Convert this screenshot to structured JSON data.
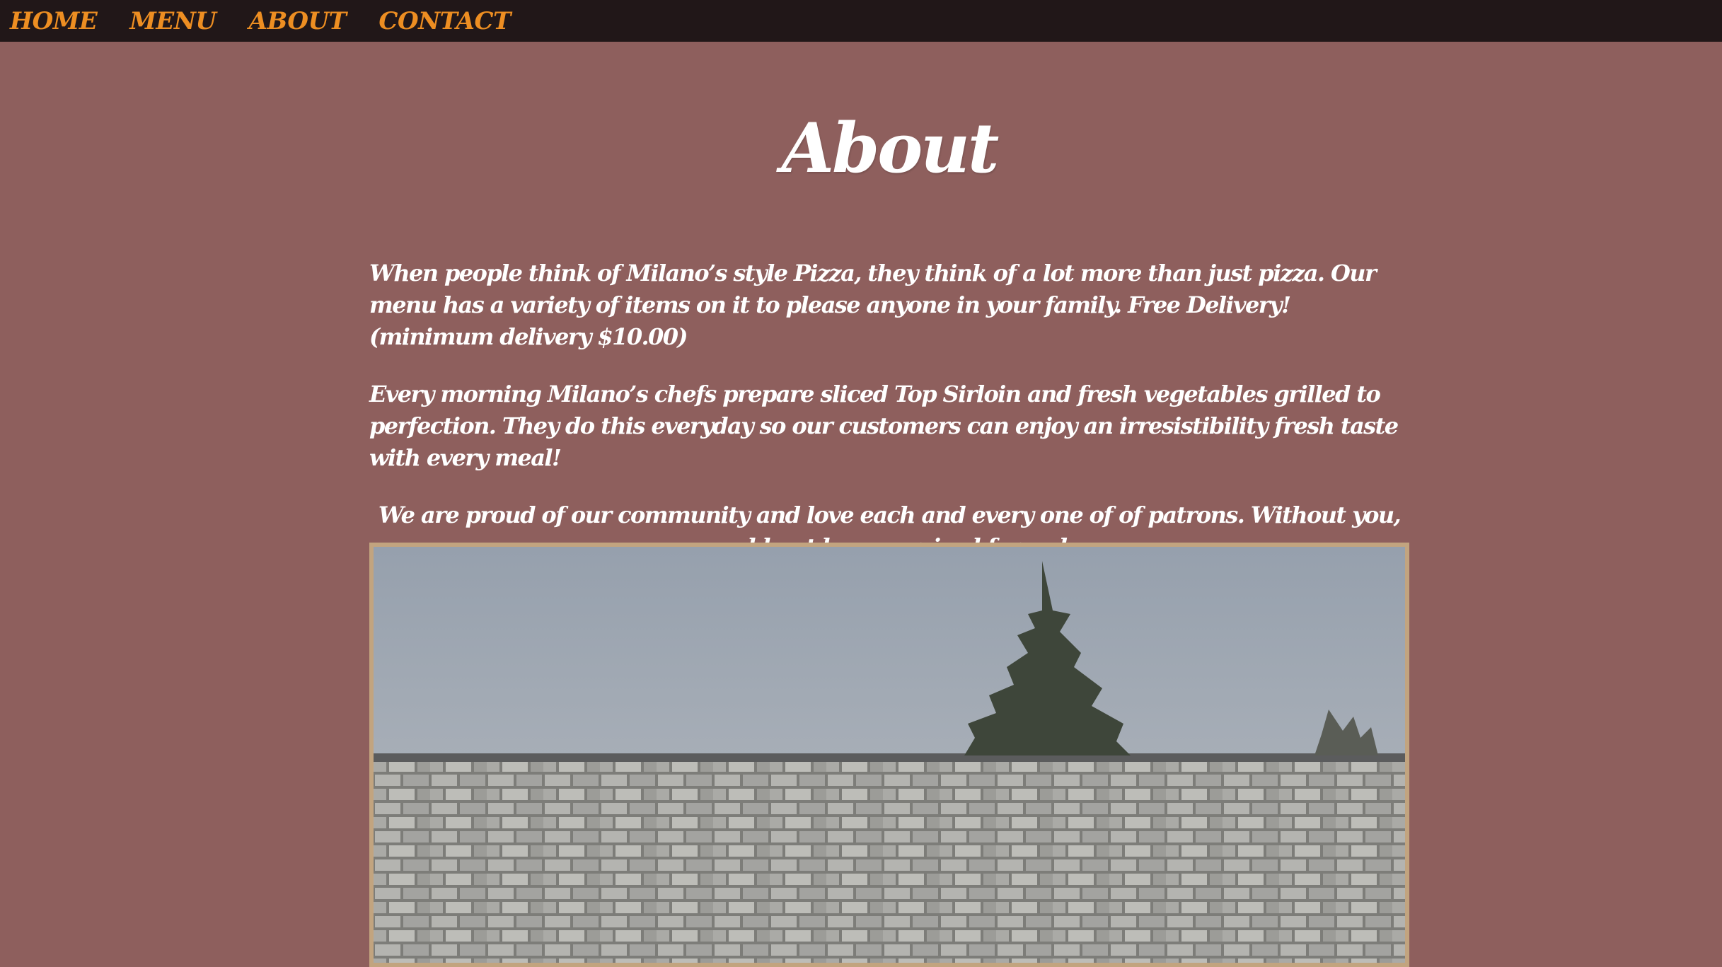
{
  "nav": {
    "items": [
      {
        "label": "HOME"
      },
      {
        "label": "MENU"
      },
      {
        "label": "ABOUT"
      },
      {
        "label": "CONTACT"
      }
    ]
  },
  "page": {
    "title": "About"
  },
  "about": {
    "paragraphs": [
      "When people think of Milano’s style Pizza, they think of a lot more than just pizza. Our menu has a variety of items on it to please anyone in your family. Free Delivery! (minimum delivery $10.00)",
      "Every morning Milano’s chefs prepare sliced Top Sirloin and fresh vegetables grilled to perfection. They do this everyday so our customers can enjoy an irresistibility fresh taste with every meal!",
      "We are proud of our community and love each and every one of of patrons. Without you, we would not have survived for so long."
    ]
  },
  "colors": {
    "background": "#8e5f5d",
    "navbar": "#211718",
    "nav_text": "#ed8e22",
    "body_text": "#ffffff",
    "frame_border": "#c2a47f"
  }
}
